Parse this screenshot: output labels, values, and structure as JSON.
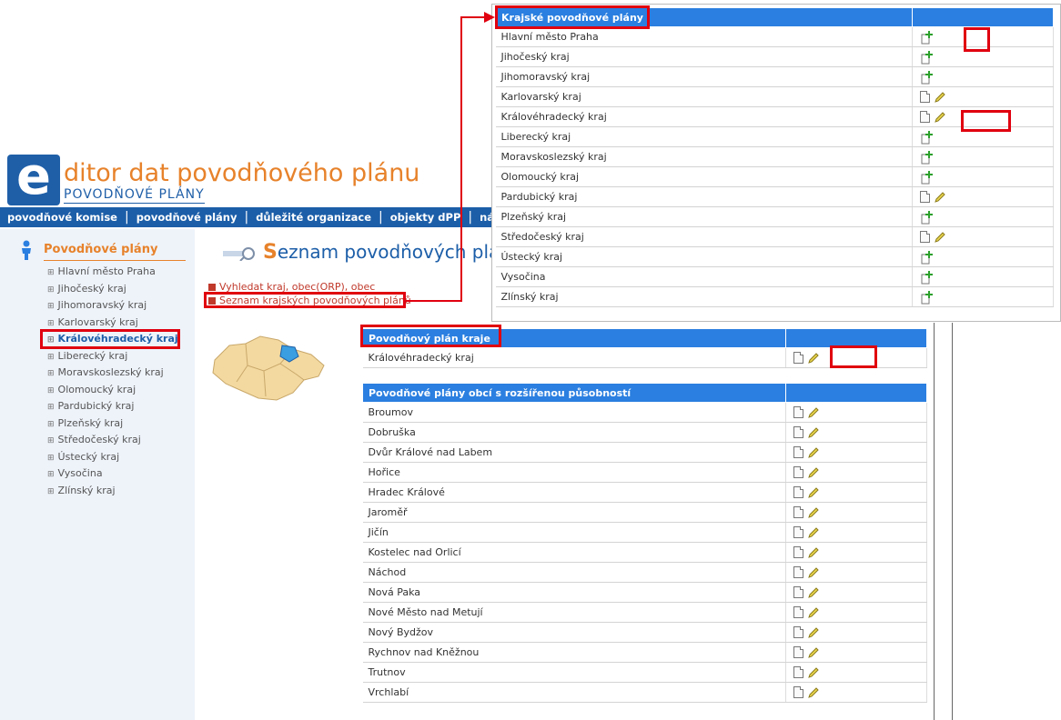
{
  "header": {
    "logo_letter": "e",
    "title": "ditor dat povodňového plánu",
    "subtitle": "POVODŇOVÉ PLÁNY"
  },
  "nav": [
    "povodňové komise",
    "povodňové plány",
    "důležité organizace",
    "objekty dPP",
    "návod"
  ],
  "sidebar": {
    "title": "Povodňové plány",
    "items": [
      "Hlavní město Praha",
      "Jihočeský kraj",
      "Jihomoravský kraj",
      "Karlovarský kraj",
      "Královéhradecký kraj",
      "Liberecký kraj",
      "Moravskoslezský kraj",
      "Olomoucký kraj",
      "Pardubický kraj",
      "Plzeňský kraj",
      "Středočeský kraj",
      "Ústecký kraj",
      "Vysočina",
      "Zlínský kraj"
    ],
    "active_index": 4
  },
  "main": {
    "title_cap": "S",
    "title_rest": "eznam povodňových plánů",
    "links": [
      "Vyhledat kraj, obec(ORP), obec",
      "Seznam krajských povodňových plánů"
    ]
  },
  "regional_table": {
    "header": "Krajské povodňové plány",
    "rows": [
      {
        "name": "Hlavní město Praha",
        "icons": "add"
      },
      {
        "name": "Jihočeský kraj",
        "icons": "add"
      },
      {
        "name": "Jihomoravský kraj",
        "icons": "add"
      },
      {
        "name": "Karlovarský kraj",
        "icons": "view-edit"
      },
      {
        "name": "Královéhradecký kraj",
        "icons": "view-edit"
      },
      {
        "name": "Liberecký kraj",
        "icons": "add"
      },
      {
        "name": "Moravskoslezský kraj",
        "icons": "add"
      },
      {
        "name": "Olomoucký kraj",
        "icons": "add"
      },
      {
        "name": "Pardubický kraj",
        "icons": "view-edit"
      },
      {
        "name": "Plzeňský kraj",
        "icons": "add"
      },
      {
        "name": "Středočeský kraj",
        "icons": "view-edit"
      },
      {
        "name": "Ústecký kraj",
        "icons": "add"
      },
      {
        "name": "Vysočina",
        "icons": "add"
      },
      {
        "name": "Zlínský kraj",
        "icons": "add"
      }
    ]
  },
  "region_plan_table": {
    "header": "Povodňový plán kraje",
    "rows": [
      {
        "name": "Královéhradecký kraj",
        "icons": "view-edit"
      }
    ]
  },
  "orp_table": {
    "header": "Povodňové plány obcí s rozšířenou působností",
    "rows": [
      "Broumov",
      "Dobruška",
      "Dvůr Králové nad Labem",
      "Hořice",
      "Hradec Králové",
      "Jaroměř",
      "Jičín",
      "Kostelec nad Orlicí",
      "Náchod",
      "Nová Paka",
      "Nové Město nad Metují",
      "Nový Bydžov",
      "Rychnov nad Kněžnou",
      "Trutnov",
      "Vrchlabí"
    ]
  },
  "colors": {
    "accent_blue": "#2b7fe0",
    "nav_blue": "#1c5ea8",
    "orange": "#e7822b",
    "highlight_red": "#e0000f"
  }
}
